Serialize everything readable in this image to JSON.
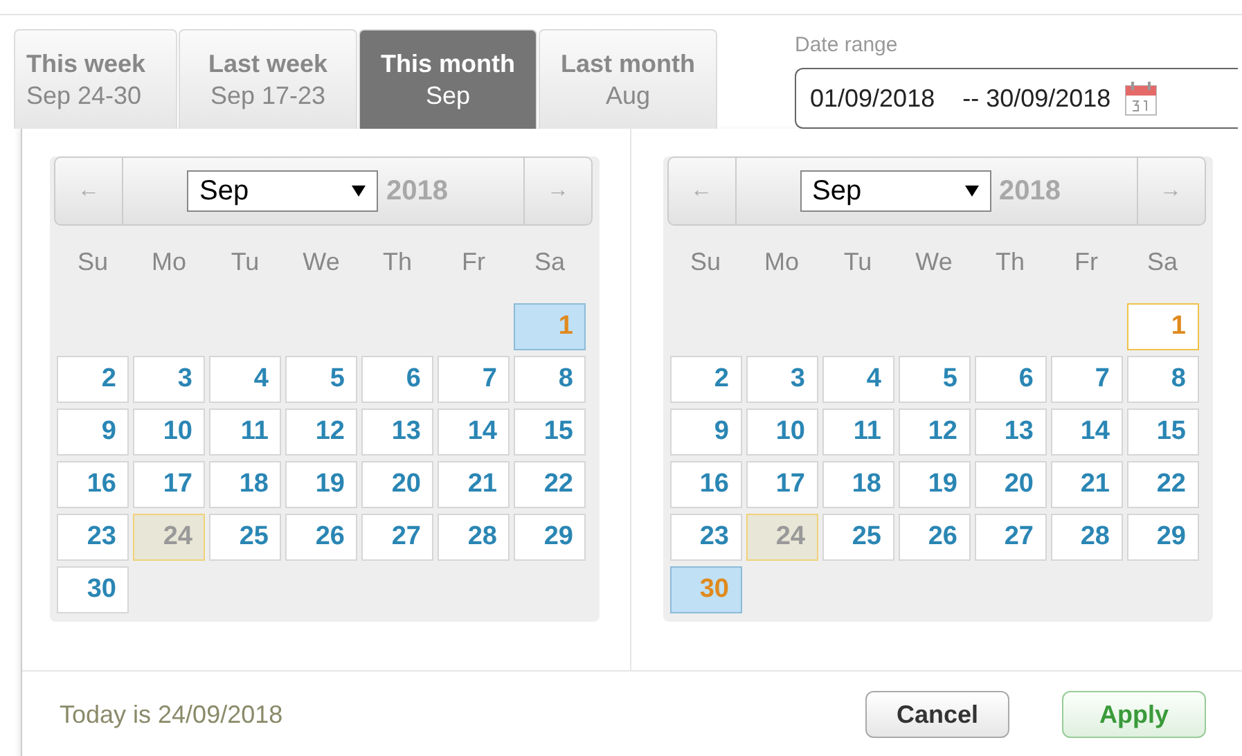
{
  "tabs": [
    {
      "label": "This week",
      "sublabel": "Sep 24-30",
      "selected": false
    },
    {
      "label": "Last week",
      "sublabel": "Sep 17-23",
      "selected": false
    },
    {
      "label": "This month",
      "sublabel": "Sep",
      "selected": true
    },
    {
      "label": "Last month",
      "sublabel": "Aug",
      "selected": false
    }
  ],
  "date_range": {
    "label": "Date range",
    "start": "01/09/2018",
    "end": "-- 30/09/2018"
  },
  "calendars": [
    {
      "prev": "←",
      "next": "→",
      "month": "Sep",
      "year": "2018",
      "weekdays": [
        "Su",
        "Mo",
        "Tu",
        "We",
        "Th",
        "Fr",
        "Sa"
      ],
      "days": [
        {
          "label": "1",
          "selected": true,
          "today": false,
          "outlined": false
        },
        {
          "label": "2",
          "selected": false,
          "today": false,
          "outlined": false
        },
        {
          "label": "3",
          "selected": false,
          "today": false,
          "outlined": false
        },
        {
          "label": "4",
          "selected": false,
          "today": false,
          "outlined": false
        },
        {
          "label": "5",
          "selected": false,
          "today": false,
          "outlined": false
        },
        {
          "label": "6",
          "selected": false,
          "today": false,
          "outlined": false
        },
        {
          "label": "7",
          "selected": false,
          "today": false,
          "outlined": false
        },
        {
          "label": "8",
          "selected": false,
          "today": false,
          "outlined": false
        },
        {
          "label": "9",
          "selected": false,
          "today": false,
          "outlined": false
        },
        {
          "label": "10",
          "selected": false,
          "today": false,
          "outlined": false
        },
        {
          "label": "11",
          "selected": false,
          "today": false,
          "outlined": false
        },
        {
          "label": "12",
          "selected": false,
          "today": false,
          "outlined": false
        },
        {
          "label": "13",
          "selected": false,
          "today": false,
          "outlined": false
        },
        {
          "label": "14",
          "selected": false,
          "today": false,
          "outlined": false
        },
        {
          "label": "15",
          "selected": false,
          "today": false,
          "outlined": false
        },
        {
          "label": "16",
          "selected": false,
          "today": false,
          "outlined": false
        },
        {
          "label": "17",
          "selected": false,
          "today": false,
          "outlined": false
        },
        {
          "label": "18",
          "selected": false,
          "today": false,
          "outlined": false
        },
        {
          "label": "19",
          "selected": false,
          "today": false,
          "outlined": false
        },
        {
          "label": "20",
          "selected": false,
          "today": false,
          "outlined": false
        },
        {
          "label": "21",
          "selected": false,
          "today": false,
          "outlined": false
        },
        {
          "label": "22",
          "selected": false,
          "today": false,
          "outlined": false
        },
        {
          "label": "23",
          "selected": false,
          "today": false,
          "outlined": false
        },
        {
          "label": "24",
          "selected": false,
          "today": true,
          "outlined": false
        },
        {
          "label": "25",
          "selected": false,
          "today": false,
          "outlined": false
        },
        {
          "label": "26",
          "selected": false,
          "today": false,
          "outlined": false
        },
        {
          "label": "27",
          "selected": false,
          "today": false,
          "outlined": false
        },
        {
          "label": "28",
          "selected": false,
          "today": false,
          "outlined": false
        },
        {
          "label": "29",
          "selected": false,
          "today": false,
          "outlined": false
        },
        {
          "label": "30",
          "selected": false,
          "today": false,
          "outlined": false
        }
      ]
    },
    {
      "prev": "←",
      "next": "→",
      "month": "Sep",
      "year": "2018",
      "weekdays": [
        "Su",
        "Mo",
        "Tu",
        "We",
        "Th",
        "Fr",
        "Sa"
      ],
      "days": [
        {
          "label": "1",
          "selected": false,
          "today": false,
          "outlined": true
        },
        {
          "label": "2",
          "selected": false,
          "today": false,
          "outlined": false
        },
        {
          "label": "3",
          "selected": false,
          "today": false,
          "outlined": false
        },
        {
          "label": "4",
          "selected": false,
          "today": false,
          "outlined": false
        },
        {
          "label": "5",
          "selected": false,
          "today": false,
          "outlined": false
        },
        {
          "label": "6",
          "selected": false,
          "today": false,
          "outlined": false
        },
        {
          "label": "7",
          "selected": false,
          "today": false,
          "outlined": false
        },
        {
          "label": "8",
          "selected": false,
          "today": false,
          "outlined": false
        },
        {
          "label": "9",
          "selected": false,
          "today": false,
          "outlined": false
        },
        {
          "label": "10",
          "selected": false,
          "today": false,
          "outlined": false
        },
        {
          "label": "11",
          "selected": false,
          "today": false,
          "outlined": false
        },
        {
          "label": "12",
          "selected": false,
          "today": false,
          "outlined": false
        },
        {
          "label": "13",
          "selected": false,
          "today": false,
          "outlined": false
        },
        {
          "label": "14",
          "selected": false,
          "today": false,
          "outlined": false
        },
        {
          "label": "15",
          "selected": false,
          "today": false,
          "outlined": false
        },
        {
          "label": "16",
          "selected": false,
          "today": false,
          "outlined": false
        },
        {
          "label": "17",
          "selected": false,
          "today": false,
          "outlined": false
        },
        {
          "label": "18",
          "selected": false,
          "today": false,
          "outlined": false
        },
        {
          "label": "19",
          "selected": false,
          "today": false,
          "outlined": false
        },
        {
          "label": "20",
          "selected": false,
          "today": false,
          "outlined": false
        },
        {
          "label": "21",
          "selected": false,
          "today": false,
          "outlined": false
        },
        {
          "label": "22",
          "selected": false,
          "today": false,
          "outlined": false
        },
        {
          "label": "23",
          "selected": false,
          "today": false,
          "outlined": false
        },
        {
          "label": "24",
          "selected": false,
          "today": true,
          "outlined": false
        },
        {
          "label": "25",
          "selected": false,
          "today": false,
          "outlined": false
        },
        {
          "label": "26",
          "selected": false,
          "today": false,
          "outlined": false
        },
        {
          "label": "27",
          "selected": false,
          "today": false,
          "outlined": false
        },
        {
          "label": "28",
          "selected": false,
          "today": false,
          "outlined": false
        },
        {
          "label": "29",
          "selected": false,
          "today": false,
          "outlined": false
        },
        {
          "label": "30",
          "selected": true,
          "today": false,
          "outlined": false
        }
      ]
    }
  ],
  "footer": {
    "today_text": "Today is 24/09/2018",
    "buttons": [
      {
        "label": "Cancel",
        "kind": "cancel"
      },
      {
        "label": "Apply",
        "kind": "apply"
      }
    ]
  }
}
